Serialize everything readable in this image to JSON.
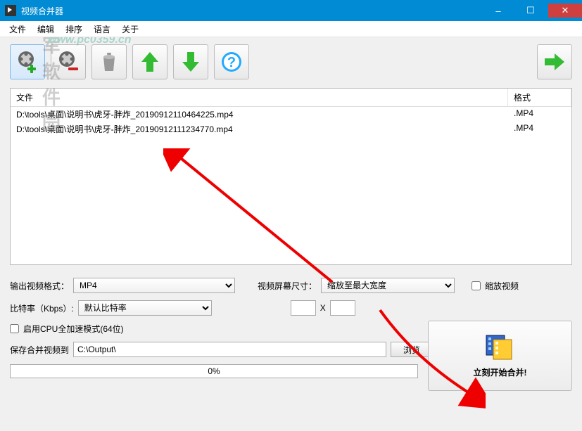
{
  "window": {
    "title": "视频合并器"
  },
  "watermark": {
    "text": "华军软件园",
    "url": "www.pc0359.cn"
  },
  "menu": {
    "file": "文件",
    "edit": "编辑",
    "sort": "排序",
    "lang": "语言",
    "about": "关于"
  },
  "winbtns": {
    "min": "–",
    "max": "☐",
    "close": "✕"
  },
  "filelist": {
    "headers": {
      "file": "文件",
      "format": "格式"
    },
    "rows": [
      {
        "path": "D:\\tools\\桌面\\说明书\\虎牙-胖炸_20190912110464225.mp4",
        "format": ".MP4"
      },
      {
        "path": "D:\\tools\\桌面\\说明书\\虎牙-胖炸_20190912111234770.mp4",
        "format": ".MP4"
      }
    ]
  },
  "opts": {
    "outfmt_label": "输出视频格式：",
    "outfmt_value": "MP4",
    "bitrate_label": "比特率（Kbps）:",
    "bitrate_value": "默认比特率",
    "screen_label": "视频屏幕尺寸：",
    "screen_value": "缩放至最大宽度",
    "xsep": "X",
    "scale_label": "缩放视频",
    "cpu_label": "启用CPU全加速模式(64位)",
    "save_label": "保存合并视频到",
    "save_path": "C:\\Output\\",
    "browse": "浏览"
  },
  "progress": {
    "text": "0%"
  },
  "merge": {
    "label": "立刻开始合并!"
  },
  "icons": {
    "add": "add-video",
    "remove": "remove-video",
    "trash": "trash",
    "up": "move-up",
    "down": "move-down",
    "help": "help",
    "next": "next"
  }
}
